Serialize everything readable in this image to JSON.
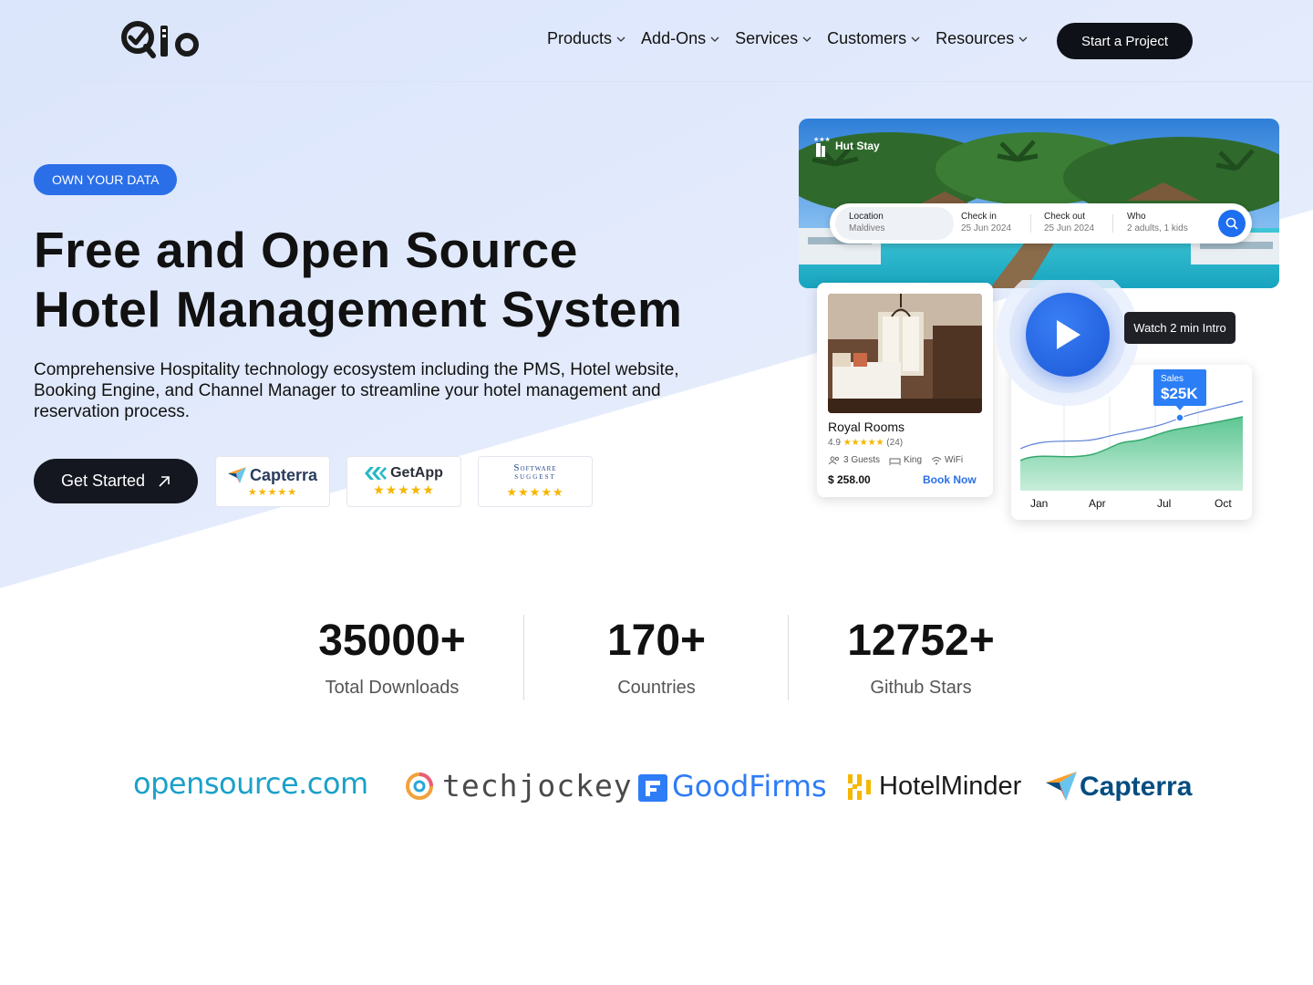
{
  "header": {
    "logo_text": "Qlo",
    "nav": [
      {
        "label": "Products"
      },
      {
        "label": "Add-Ons"
      },
      {
        "label": "Services"
      },
      {
        "label": "Customers"
      },
      {
        "label": "Resources"
      }
    ],
    "cta_label": "Start a Project"
  },
  "hero": {
    "badge": "OWN YOUR DATA",
    "title_line1": "Free and Open Source",
    "title_line2": "Hotel Management System",
    "description": "Comprehensive Hospitality technology ecosystem including the PMS, Hotel website, Booking Engine, and Channel Manager to streamline your hotel management and reservation process.",
    "get_started_label": "Get Started",
    "ratings": [
      {
        "name": "Capterra",
        "stars": "★★★★★"
      },
      {
        "name": "GetApp",
        "stars": "★★★★★"
      },
      {
        "name": "Software Suggest",
        "stars": "★★★★★"
      }
    ]
  },
  "mock": {
    "brand": "Hut Stay",
    "search": {
      "location_label": "Location",
      "location_value": "Maldives",
      "checkin_label": "Check in",
      "checkin_value": "25 Jun 2024",
      "checkout_label": "Check out",
      "checkout_value": "25 Jun 2024",
      "who_label": "Who",
      "who_value": "2 adults, 1 kids"
    },
    "room": {
      "name": "Royal Rooms",
      "rating": "4.9",
      "stars": "★★★★★",
      "reviews": "(24)",
      "guests": "3 Guests",
      "bed": "King",
      "wifi": "WiFi",
      "price": "$ 258.00",
      "book_label": "Book Now"
    },
    "watch_label": "Watch 2 min Intro",
    "sales_label": "Sales",
    "sales_value": "$25K",
    "chart_months": [
      "Jan",
      "Apr",
      "Jul",
      "Oct"
    ]
  },
  "stats": [
    {
      "value": "35000+",
      "label": "Total Downloads"
    },
    {
      "value": "170+",
      "label": "Countries"
    },
    {
      "value": "12752+",
      "label": "Github Stars"
    }
  ],
  "partners": {
    "opensource": "opensource.com",
    "techjockey": "techjockey",
    "goodfirms": "GoodFirms",
    "hotelminder": "HotelMinder",
    "capterra": "Capterra"
  },
  "colors": {
    "accent": "#2b6fe8",
    "dark": "#111317",
    "hero_bg": "#dde6fb"
  }
}
